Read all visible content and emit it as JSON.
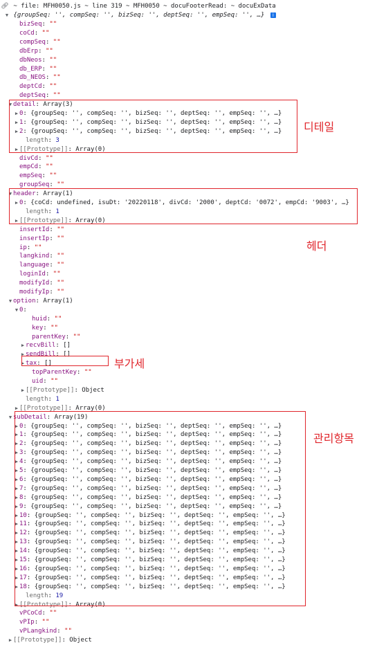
{
  "header": {
    "log_text": "~ file: MFH0050.js ~ line 319 ~ MFH0050 ~ docuFooterRead: ~ docuExData"
  },
  "object_preview": "{groupSeq: '', compSeq: '', bizSeq: '', deptSeq: '', empSeq: '', …}",
  "rows": [
    {
      "d": 2,
      "key": "bizSeq",
      "sep": ": ",
      "val": "\"\"",
      "vc": "s"
    },
    {
      "d": 2,
      "key": "coCd",
      "sep": ": ",
      "val": "\"\"",
      "vc": "s"
    },
    {
      "d": 2,
      "key": "compSeq",
      "sep": ": ",
      "val": "\"\"",
      "vc": "s"
    },
    {
      "d": 2,
      "key": "dbErp",
      "sep": ": ",
      "val": "\"\"",
      "vc": "s"
    },
    {
      "d": 2,
      "key": "dbNeos",
      "sep": ": ",
      "val": "\"\"",
      "vc": "s"
    },
    {
      "d": 2,
      "key": "db_ERP",
      "sep": ": ",
      "val": "\"\"",
      "vc": "s"
    },
    {
      "d": 2,
      "key": "db_NEOS",
      "sep": ": ",
      "val": "\"\"",
      "vc": "s"
    },
    {
      "d": 2,
      "key": "deptCd",
      "sep": ": ",
      "val": "\"\"",
      "vc": "s"
    },
    {
      "d": 2,
      "key": "deptSeq",
      "sep": ": ",
      "val": "\"\"",
      "vc": "s"
    },
    {
      "d": 1,
      "t": "v",
      "key": "detail",
      "sep": ": ",
      "val": "Array(3)",
      "vc": "p"
    },
    {
      "d": 2,
      "t": ">",
      "key": "0",
      "sep": ": ",
      "val": "{groupSeq: '', compSeq: '', bizSeq: '', deptSeq: '', empSeq: '', …}",
      "vc": "p"
    },
    {
      "d": 2,
      "t": ">",
      "key": "1",
      "sep": ": ",
      "val": "{groupSeq: '', compSeq: '', bizSeq: '', deptSeq: '', empSeq: '', …}",
      "vc": "p"
    },
    {
      "d": 2,
      "t": ">",
      "key": "2",
      "sep": ": ",
      "val": "{groupSeq: '', compSeq: '', bizSeq: '', deptSeq: '', empSeq: '', …}",
      "vc": "p"
    },
    {
      "d": 3,
      "key": "length",
      "sep": ": ",
      "val": "3",
      "vc": "n",
      "kc": "kg"
    },
    {
      "d": 2,
      "t": ">",
      "key": "[[Prototype]]",
      "sep": ": ",
      "val": "Array(0)",
      "vc": "p",
      "kc": "kg"
    },
    {
      "d": 2,
      "key": "divCd",
      "sep": ": ",
      "val": "\"\"",
      "vc": "s"
    },
    {
      "d": 2,
      "key": "empCd",
      "sep": ": ",
      "val": "\"\"",
      "vc": "s"
    },
    {
      "d": 2,
      "key": "empSeq",
      "sep": ": ",
      "val": "\"\"",
      "vc": "s"
    },
    {
      "d": 2,
      "key": "groupSeq",
      "sep": ": ",
      "val": "\"\"",
      "vc": "s"
    },
    {
      "d": 1,
      "t": "v",
      "key": "header",
      "sep": ": ",
      "val": "Array(1)",
      "vc": "p"
    },
    {
      "d": 2,
      "t": ">",
      "key": "0",
      "sep": ": ",
      "val": "{coCd: undefined, isuDt: '20220118', divCd: '2000', deptCd: '0072', empCd: '9003', …}",
      "vc": "p"
    },
    {
      "d": 3,
      "key": "length",
      "sep": ": ",
      "val": "1",
      "vc": "n",
      "kc": "kg"
    },
    {
      "d": 2,
      "t": ">",
      "key": "[[Prototype]]",
      "sep": ": ",
      "val": "Array(0)",
      "vc": "p",
      "kc": "kg"
    },
    {
      "d": 2,
      "key": "insertId",
      "sep": ": ",
      "val": "\"\"",
      "vc": "s"
    },
    {
      "d": 2,
      "key": "insertIp",
      "sep": ": ",
      "val": "\"\"",
      "vc": "s"
    },
    {
      "d": 2,
      "key": "ip",
      "sep": ": ",
      "val": "\"\"",
      "vc": "s"
    },
    {
      "d": 2,
      "key": "langkind",
      "sep": ": ",
      "val": "\"\"",
      "vc": "s"
    },
    {
      "d": 2,
      "key": "language",
      "sep": ": ",
      "val": "\"\"",
      "vc": "s"
    },
    {
      "d": 2,
      "key": "loginId",
      "sep": ": ",
      "val": "\"\"",
      "vc": "s"
    },
    {
      "d": 2,
      "key": "modifyId",
      "sep": ": ",
      "val": "\"\"",
      "vc": "s"
    },
    {
      "d": 2,
      "key": "modifyIp",
      "sep": ": ",
      "val": "\"\"",
      "vc": "s"
    },
    {
      "d": 1,
      "t": "v",
      "key": "option",
      "sep": ": ",
      "val": "Array(1)",
      "vc": "p"
    },
    {
      "d": 2,
      "t": "v",
      "key": "0",
      "sep": ":",
      "val": "",
      "vc": "p"
    },
    {
      "d": 4,
      "key": "huid",
      "sep": ": ",
      "val": "\"\"",
      "vc": "s"
    },
    {
      "d": 4,
      "key": "key",
      "sep": ": ",
      "val": "\"\"",
      "vc": "s"
    },
    {
      "d": 4,
      "key": "parentKey",
      "sep": ": ",
      "val": "\"\"",
      "vc": "s"
    },
    {
      "d": 3,
      "t": ">",
      "key": "recvBill",
      "sep": ": ",
      "val": "[]",
      "vc": "p"
    },
    {
      "d": 3,
      "t": ">",
      "key": "sendBill",
      "sep": ": ",
      "val": "[]",
      "vc": "p"
    },
    {
      "d": 3,
      "t": ">",
      "key": "tax",
      "sep": ": ",
      "val": "[]",
      "vc": "p"
    },
    {
      "d": 4,
      "key": "topParentKey",
      "sep": ": ",
      "val": "\"\"",
      "vc": "s"
    },
    {
      "d": 4,
      "key": "uid",
      "sep": ": ",
      "val": "\"\"",
      "vc": "s"
    },
    {
      "d": 3,
      "t": ">",
      "key": "[[Prototype]]",
      "sep": ": ",
      "val": "Object",
      "vc": "p",
      "kc": "kg"
    },
    {
      "d": 3,
      "key": "length",
      "sep": ": ",
      "val": "1",
      "vc": "n",
      "kc": "kg"
    },
    {
      "d": 2,
      "t": ">",
      "key": "[[Prototype]]",
      "sep": ": ",
      "val": "Array(0)",
      "vc": "p",
      "kc": "kg"
    },
    {
      "d": 1,
      "t": "v",
      "key": "subDetail",
      "sep": ": ",
      "val": "Array(19)",
      "vc": "p"
    },
    {
      "d": 2,
      "t": ">",
      "key": "0",
      "sep": ": ",
      "val": "{groupSeq: '', compSeq: '', bizSeq: '', deptSeq: '', empSeq: '', …}",
      "vc": "p"
    },
    {
      "d": 2,
      "t": ">",
      "key": "1",
      "sep": ": ",
      "val": "{groupSeq: '', compSeq: '', bizSeq: '', deptSeq: '', empSeq: '', …}",
      "vc": "p"
    },
    {
      "d": 2,
      "t": ">",
      "key": "2",
      "sep": ": ",
      "val": "{groupSeq: '', compSeq: '', bizSeq: '', deptSeq: '', empSeq: '', …}",
      "vc": "p"
    },
    {
      "d": 2,
      "t": ">",
      "key": "3",
      "sep": ": ",
      "val": "{groupSeq: '', compSeq: '', bizSeq: '', deptSeq: '', empSeq: '', …}",
      "vc": "p"
    },
    {
      "d": 2,
      "t": ">",
      "key": "4",
      "sep": ": ",
      "val": "{groupSeq: '', compSeq: '', bizSeq: '', deptSeq: '', empSeq: '', …}",
      "vc": "p"
    },
    {
      "d": 2,
      "t": ">",
      "key": "5",
      "sep": ": ",
      "val": "{groupSeq: '', compSeq: '', bizSeq: '', deptSeq: '', empSeq: '', …}",
      "vc": "p"
    },
    {
      "d": 2,
      "t": ">",
      "key": "6",
      "sep": ": ",
      "val": "{groupSeq: '', compSeq: '', bizSeq: '', deptSeq: '', empSeq: '', …}",
      "vc": "p"
    },
    {
      "d": 2,
      "t": ">",
      "key": "7",
      "sep": ": ",
      "val": "{groupSeq: '', compSeq: '', bizSeq: '', deptSeq: '', empSeq: '', …}",
      "vc": "p"
    },
    {
      "d": 2,
      "t": ">",
      "key": "8",
      "sep": ": ",
      "val": "{groupSeq: '', compSeq: '', bizSeq: '', deptSeq: '', empSeq: '', …}",
      "vc": "p"
    },
    {
      "d": 2,
      "t": ">",
      "key": "9",
      "sep": ": ",
      "val": "{groupSeq: '', compSeq: '', bizSeq: '', deptSeq: '', empSeq: '', …}",
      "vc": "p"
    },
    {
      "d": 2,
      "t": ">",
      "key": "10",
      "sep": ": ",
      "val": "{groupSeq: '', compSeq: '', bizSeq: '', deptSeq: '', empSeq: '', …}",
      "vc": "p"
    },
    {
      "d": 2,
      "t": ">",
      "key": "11",
      "sep": ": ",
      "val": "{groupSeq: '', compSeq: '', bizSeq: '', deptSeq: '', empSeq: '', …}",
      "vc": "p"
    },
    {
      "d": 2,
      "t": ">",
      "key": "12",
      "sep": ": ",
      "val": "{groupSeq: '', compSeq: '', bizSeq: '', deptSeq: '', empSeq: '', …}",
      "vc": "p"
    },
    {
      "d": 2,
      "t": ">",
      "key": "13",
      "sep": ": ",
      "val": "{groupSeq: '', compSeq: '', bizSeq: '', deptSeq: '', empSeq: '', …}",
      "vc": "p"
    },
    {
      "d": 2,
      "t": ">",
      "key": "14",
      "sep": ": ",
      "val": "{groupSeq: '', compSeq: '', bizSeq: '', deptSeq: '', empSeq: '', …}",
      "vc": "p"
    },
    {
      "d": 2,
      "t": ">",
      "key": "15",
      "sep": ": ",
      "val": "{groupSeq: '', compSeq: '', bizSeq: '', deptSeq: '', empSeq: '', …}",
      "vc": "p"
    },
    {
      "d": 2,
      "t": ">",
      "key": "16",
      "sep": ": ",
      "val": "{groupSeq: '', compSeq: '', bizSeq: '', deptSeq: '', empSeq: '', …}",
      "vc": "p"
    },
    {
      "d": 2,
      "t": ">",
      "key": "17",
      "sep": ": ",
      "val": "{groupSeq: '', compSeq: '', bizSeq: '', deptSeq: '', empSeq: '', …}",
      "vc": "p"
    },
    {
      "d": 2,
      "t": ">",
      "key": "18",
      "sep": ": ",
      "val": "{groupSeq: '', compSeq: '', bizSeq: '', deptSeq: '', empSeq: '', …}",
      "vc": "p"
    },
    {
      "d": 3,
      "key": "length",
      "sep": ": ",
      "val": "19",
      "vc": "n",
      "kc": "kg"
    },
    {
      "d": 2,
      "t": ">",
      "key": "[[Prototype]]",
      "sep": ": ",
      "val": "Array(0)",
      "vc": "p",
      "kc": "kg"
    },
    {
      "d": 2,
      "key": "vPCoCd",
      "sep": ": ",
      "val": "\"\"",
      "vc": "s"
    },
    {
      "d": 2,
      "key": "vPIp",
      "sep": ": ",
      "val": "\"\"",
      "vc": "s"
    },
    {
      "d": 2,
      "key": "vPLangkind",
      "sep": ": ",
      "val": "\"\"",
      "vc": "s"
    },
    {
      "d": 1,
      "t": ">",
      "key": "[[Prototype]]",
      "sep": ": ",
      "val": "Object",
      "vc": "p",
      "kc": "kg"
    }
  ],
  "annotations": {
    "detail": "디테일",
    "header": "헤더",
    "tax": "부가세",
    "subDetail": "관리항목"
  },
  "colors": {
    "annotation": "#e0252b",
    "key": "#881280",
    "string": "#c80000",
    "number": "#1a1aa6"
  }
}
